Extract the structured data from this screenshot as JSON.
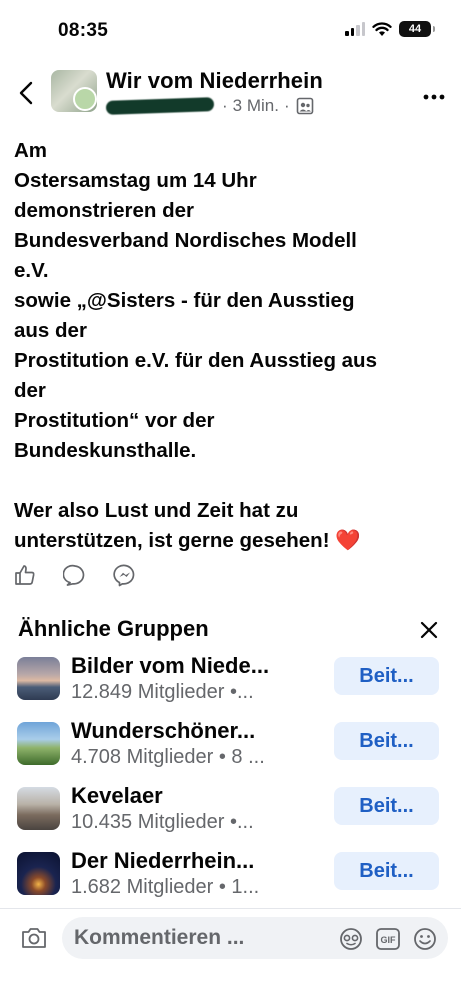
{
  "status_bar": {
    "time": "08:35",
    "battery": "44"
  },
  "post": {
    "group_name": "Wir vom Niederrhein",
    "time_ago": "3 Min.",
    "separator": "·",
    "lines": [
      "Am",
      "Ostersamstag um 14 Uhr",
      "demonstrieren der",
      "Bundesverband Nordisches Modell",
      "e.V.",
      "sowie „@Sisters - für den Ausstieg",
      "aus der",
      "Prostitution e.V. für den Ausstieg aus",
      "der",
      "Prostitution“ vor der",
      "Bundeskunsthalle.",
      "",
      "Wer also Lust und Zeit hat zu",
      "unterstützen, ist gerne gesehen! ❤️"
    ]
  },
  "similar_groups": {
    "title": "Ähnliche Gruppen",
    "join_label": "Beit...",
    "items": [
      {
        "name": "Bilder vom Niede...",
        "members": "12.849 Mitglieder •..."
      },
      {
        "name": "Wunderschöner...",
        "members": "4.708 Mitglieder • 8 ..."
      },
      {
        "name": "Kevelaer",
        "members": "10.435 Mitglieder •..."
      },
      {
        "name": "Der Niederrhein...",
        "members": "1.682 Mitglieder • 1..."
      }
    ]
  },
  "comment": {
    "placeholder": "Kommentieren ..."
  },
  "colors": {
    "accent": "#1f5fc4",
    "join_bg": "#e7f0fd",
    "muted": "#65676b",
    "heart": "#e0245e"
  },
  "icons": [
    "back-icon",
    "more-icon",
    "like-icon",
    "comment-icon",
    "share-icon",
    "close-icon",
    "camera-icon",
    "avatar-sticker-icon",
    "gif-icon",
    "emoji-icon"
  ]
}
